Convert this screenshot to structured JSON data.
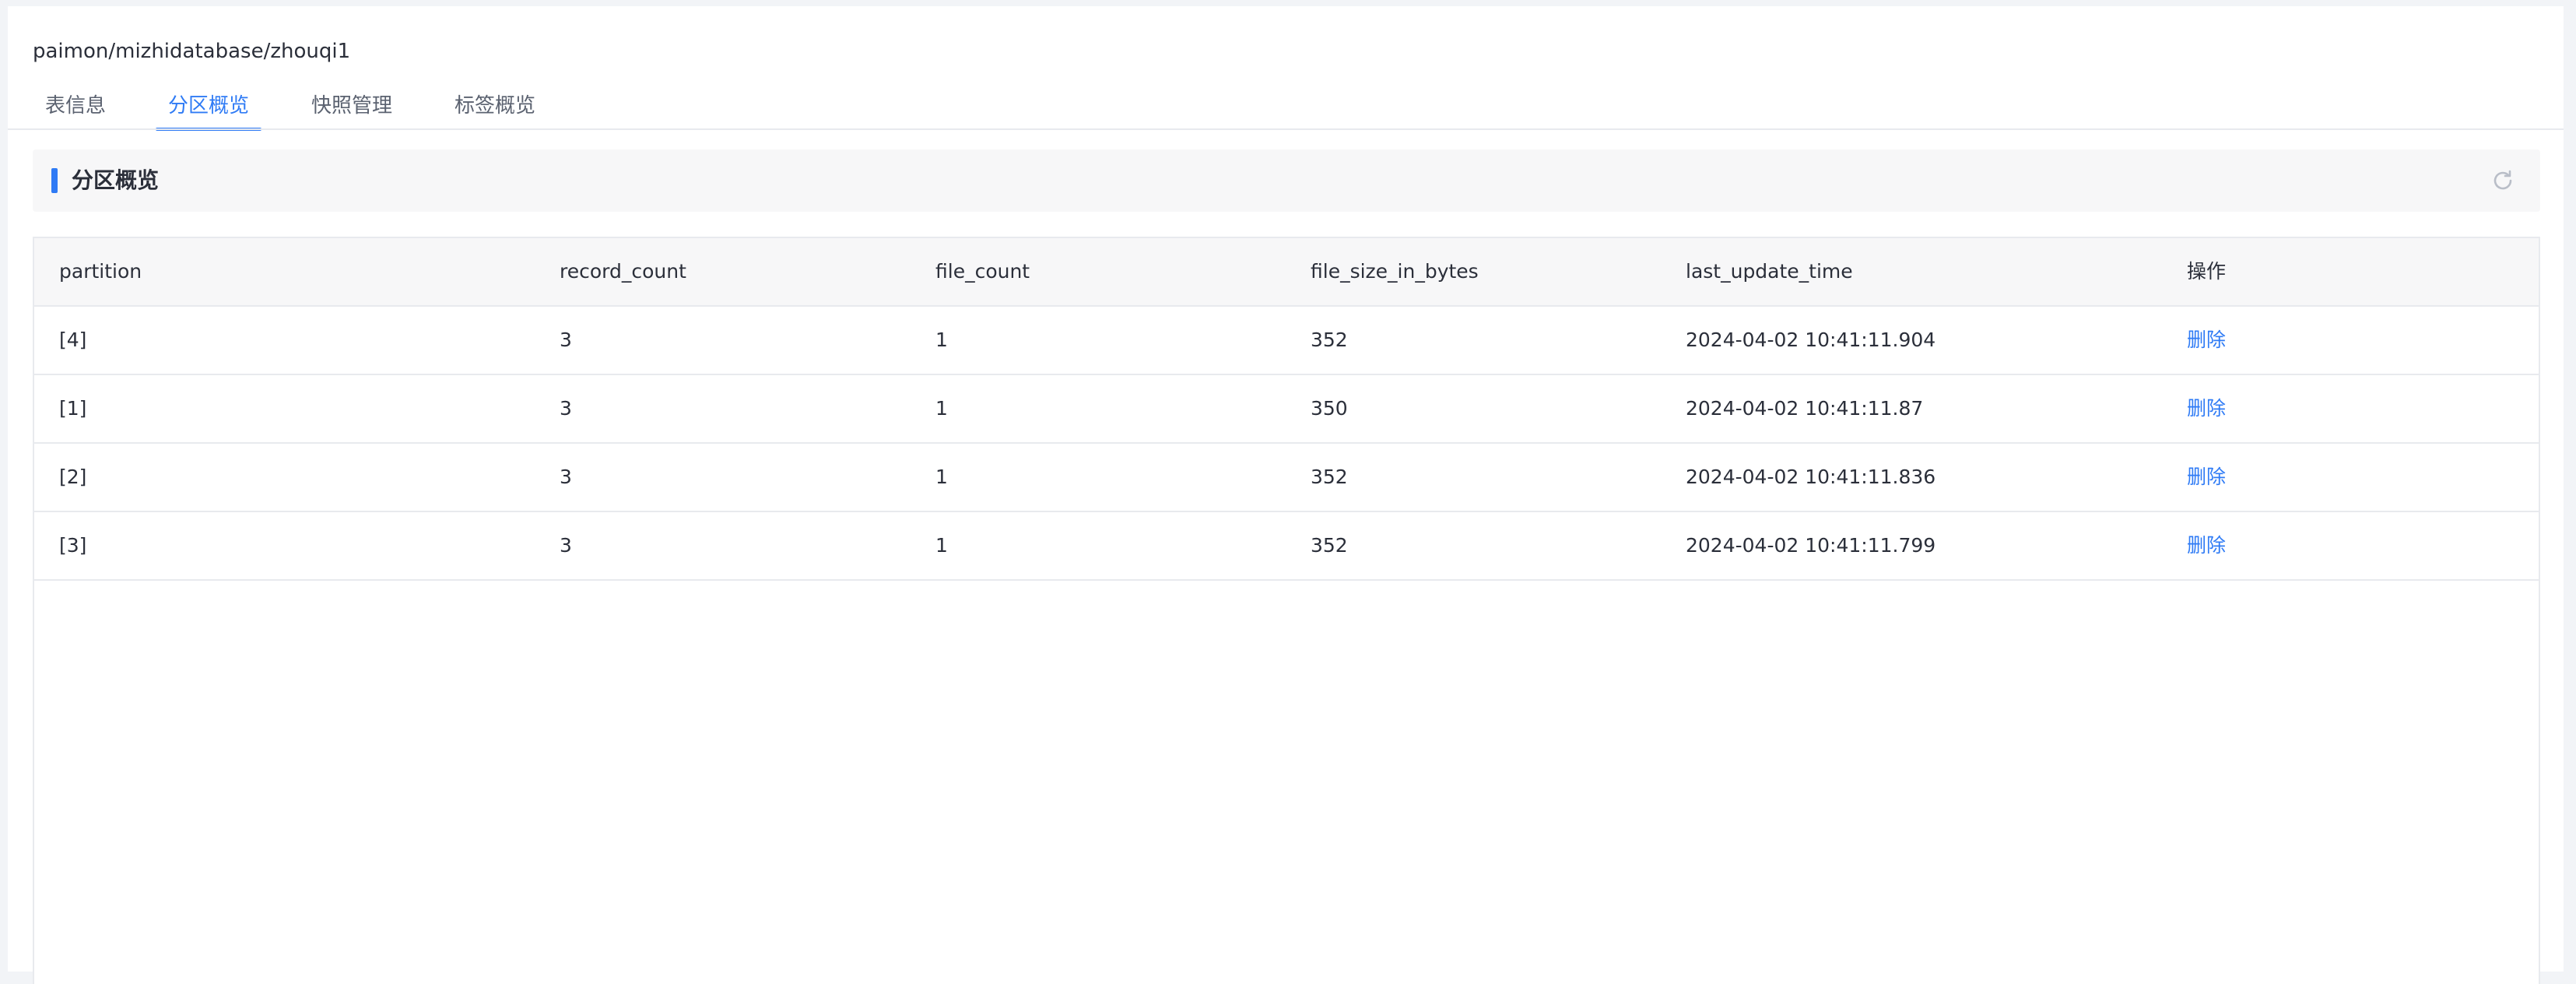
{
  "header": {
    "path": "paimon/mizhidatabase/zhouqi1"
  },
  "tabs": [
    {
      "label": "表信息",
      "active": false
    },
    {
      "label": "分区概览",
      "active": true
    },
    {
      "label": "快照管理",
      "active": false
    },
    {
      "label": "标签概览",
      "active": false
    }
  ],
  "section": {
    "title": "分区概览",
    "refresh_icon": "refresh-icon",
    "accent_color": "#2f7bf5"
  },
  "table": {
    "columns": [
      "partition",
      "record_count",
      "file_count",
      "file_size_in_bytes",
      "last_update_time",
      "操作"
    ],
    "rows": [
      {
        "partition": "[4]",
        "record_count": "3",
        "file_count": "1",
        "file_size_in_bytes": "352",
        "last_update_time": "2024-04-02 10:41:11.904",
        "action": "删除"
      },
      {
        "partition": "[1]",
        "record_count": "3",
        "file_count": "1",
        "file_size_in_bytes": "350",
        "last_update_time": "2024-04-02 10:41:11.87",
        "action": "删除"
      },
      {
        "partition": "[2]",
        "record_count": "3",
        "file_count": "1",
        "file_size_in_bytes": "352",
        "last_update_time": "2024-04-02 10:41:11.836",
        "action": "删除"
      },
      {
        "partition": "[3]",
        "record_count": "3",
        "file_count": "1",
        "file_size_in_bytes": "352",
        "last_update_time": "2024-04-02 10:41:11.799",
        "action": "删除"
      }
    ]
  }
}
